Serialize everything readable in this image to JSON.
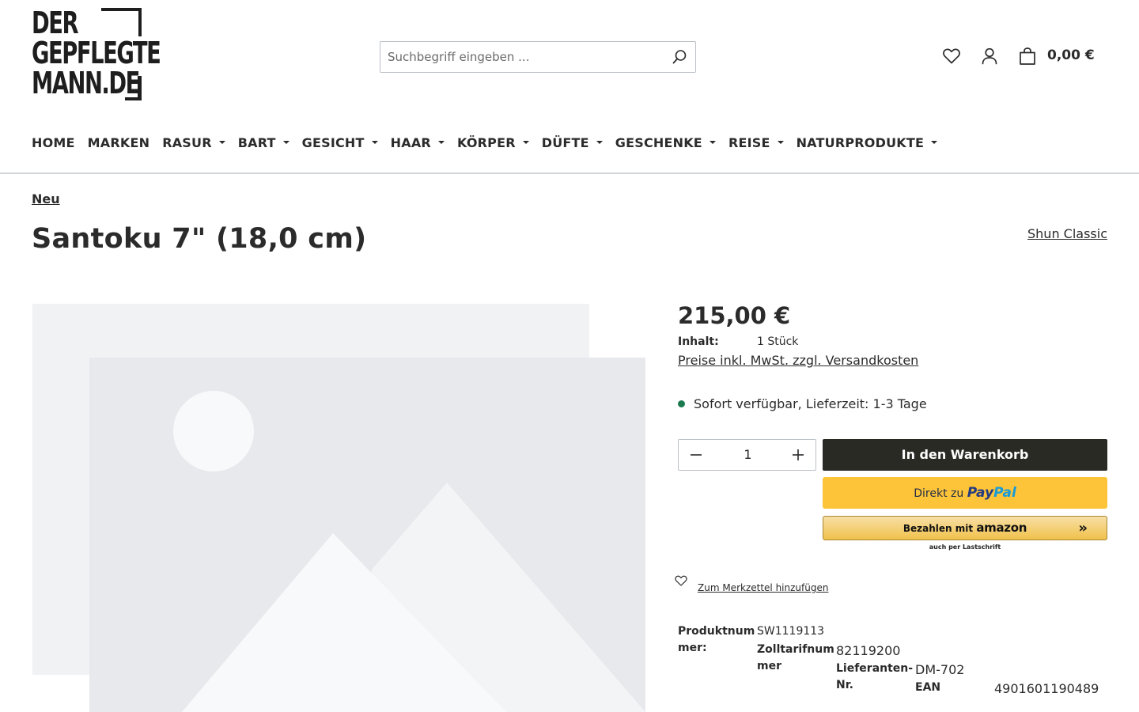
{
  "logo": {
    "line1": "DER",
    "line2": "GEPFLEGTE",
    "line3": "MANN.DE"
  },
  "search": {
    "placeholder": "Suchbegriff eingeben ..."
  },
  "header": {
    "cart_total": "0,00 €"
  },
  "nav": [
    {
      "label": "HOME",
      "dropdown": false
    },
    {
      "label": "MARKEN",
      "dropdown": false
    },
    {
      "label": "RASUR",
      "dropdown": true
    },
    {
      "label": "BART",
      "dropdown": true
    },
    {
      "label": "GESICHT",
      "dropdown": true
    },
    {
      "label": "HAAR",
      "dropdown": true
    },
    {
      "label": "KÖRPER",
      "dropdown": true
    },
    {
      "label": "DÜFTE",
      "dropdown": true
    },
    {
      "label": "GESCHENKE",
      "dropdown": true
    },
    {
      "label": "REISE",
      "dropdown": true
    },
    {
      "label": "NATURPRODUKTE",
      "dropdown": true
    }
  ],
  "breadcrumb": "Neu",
  "product": {
    "title": "Santoku 7\" (18,0 cm)",
    "brand": "Shun Classic",
    "price": "215,00 €",
    "content_label": "Inhalt:",
    "content_value": "1 Stück",
    "tax_note": "Preise inkl. MwSt. zzgl. Versandkosten",
    "availability": "Sofort verfügbar, Lieferzeit: 1-3 Tage",
    "availability_color": "#1c7a4f",
    "quantity": "1"
  },
  "buttons": {
    "add_to_cart": "In den Warenkorb",
    "paypal_prefix": "Direkt zu",
    "paypal_brand_1": "Pay",
    "paypal_brand_2": "Pal",
    "amazon_prefix": "Bezahlen mit",
    "amazon_brand": "amazon",
    "amazon_sub": "auch per Lastschrift",
    "wishlist": "Zum Merkzettel hinzufügen"
  },
  "specs": {
    "product_number_label": "Produktnummer:",
    "product_number": "SW1119113",
    "tariff_label": "Zolltarifnummer",
    "tariff": "82119200",
    "supplier_label": "Lieferanten-Nr.",
    "supplier": "DM-702",
    "ean_label": "EAN",
    "ean": "4901601190489"
  },
  "colors": {
    "cart_button": "#2a2a25",
    "paypal": "#fdc43a",
    "amazon": "#f0c14b"
  }
}
